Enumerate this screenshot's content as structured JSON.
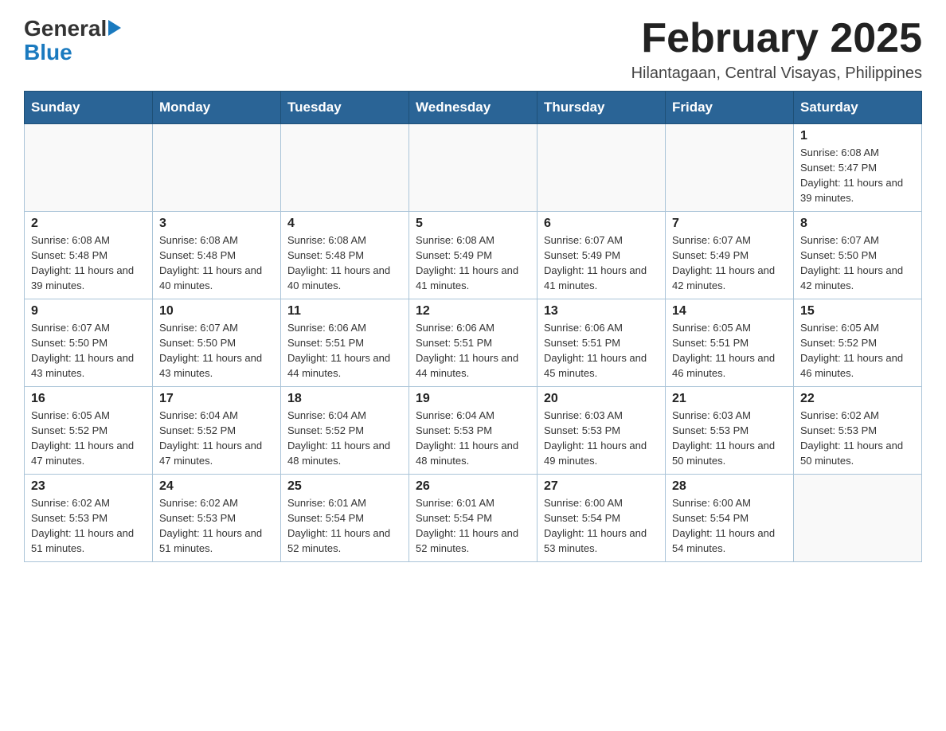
{
  "logo": {
    "general": "General",
    "blue": "Blue",
    "arrow": "▶"
  },
  "header": {
    "title": "February 2025",
    "subtitle": "Hilantagaan, Central Visayas, Philippines"
  },
  "days_of_week": [
    "Sunday",
    "Monday",
    "Tuesday",
    "Wednesday",
    "Thursday",
    "Friday",
    "Saturday"
  ],
  "weeks": [
    [
      {
        "day": "",
        "info": ""
      },
      {
        "day": "",
        "info": ""
      },
      {
        "day": "",
        "info": ""
      },
      {
        "day": "",
        "info": ""
      },
      {
        "day": "",
        "info": ""
      },
      {
        "day": "",
        "info": ""
      },
      {
        "day": "1",
        "info": "Sunrise: 6:08 AM\nSunset: 5:47 PM\nDaylight: 11 hours and 39 minutes."
      }
    ],
    [
      {
        "day": "2",
        "info": "Sunrise: 6:08 AM\nSunset: 5:48 PM\nDaylight: 11 hours and 39 minutes."
      },
      {
        "day": "3",
        "info": "Sunrise: 6:08 AM\nSunset: 5:48 PM\nDaylight: 11 hours and 40 minutes."
      },
      {
        "day": "4",
        "info": "Sunrise: 6:08 AM\nSunset: 5:48 PM\nDaylight: 11 hours and 40 minutes."
      },
      {
        "day": "5",
        "info": "Sunrise: 6:08 AM\nSunset: 5:49 PM\nDaylight: 11 hours and 41 minutes."
      },
      {
        "day": "6",
        "info": "Sunrise: 6:07 AM\nSunset: 5:49 PM\nDaylight: 11 hours and 41 minutes."
      },
      {
        "day": "7",
        "info": "Sunrise: 6:07 AM\nSunset: 5:49 PM\nDaylight: 11 hours and 42 minutes."
      },
      {
        "day": "8",
        "info": "Sunrise: 6:07 AM\nSunset: 5:50 PM\nDaylight: 11 hours and 42 minutes."
      }
    ],
    [
      {
        "day": "9",
        "info": "Sunrise: 6:07 AM\nSunset: 5:50 PM\nDaylight: 11 hours and 43 minutes."
      },
      {
        "day": "10",
        "info": "Sunrise: 6:07 AM\nSunset: 5:50 PM\nDaylight: 11 hours and 43 minutes."
      },
      {
        "day": "11",
        "info": "Sunrise: 6:06 AM\nSunset: 5:51 PM\nDaylight: 11 hours and 44 minutes."
      },
      {
        "day": "12",
        "info": "Sunrise: 6:06 AM\nSunset: 5:51 PM\nDaylight: 11 hours and 44 minutes."
      },
      {
        "day": "13",
        "info": "Sunrise: 6:06 AM\nSunset: 5:51 PM\nDaylight: 11 hours and 45 minutes."
      },
      {
        "day": "14",
        "info": "Sunrise: 6:05 AM\nSunset: 5:51 PM\nDaylight: 11 hours and 46 minutes."
      },
      {
        "day": "15",
        "info": "Sunrise: 6:05 AM\nSunset: 5:52 PM\nDaylight: 11 hours and 46 minutes."
      }
    ],
    [
      {
        "day": "16",
        "info": "Sunrise: 6:05 AM\nSunset: 5:52 PM\nDaylight: 11 hours and 47 minutes."
      },
      {
        "day": "17",
        "info": "Sunrise: 6:04 AM\nSunset: 5:52 PM\nDaylight: 11 hours and 47 minutes."
      },
      {
        "day": "18",
        "info": "Sunrise: 6:04 AM\nSunset: 5:52 PM\nDaylight: 11 hours and 48 minutes."
      },
      {
        "day": "19",
        "info": "Sunrise: 6:04 AM\nSunset: 5:53 PM\nDaylight: 11 hours and 48 minutes."
      },
      {
        "day": "20",
        "info": "Sunrise: 6:03 AM\nSunset: 5:53 PM\nDaylight: 11 hours and 49 minutes."
      },
      {
        "day": "21",
        "info": "Sunrise: 6:03 AM\nSunset: 5:53 PM\nDaylight: 11 hours and 50 minutes."
      },
      {
        "day": "22",
        "info": "Sunrise: 6:02 AM\nSunset: 5:53 PM\nDaylight: 11 hours and 50 minutes."
      }
    ],
    [
      {
        "day": "23",
        "info": "Sunrise: 6:02 AM\nSunset: 5:53 PM\nDaylight: 11 hours and 51 minutes."
      },
      {
        "day": "24",
        "info": "Sunrise: 6:02 AM\nSunset: 5:53 PM\nDaylight: 11 hours and 51 minutes."
      },
      {
        "day": "25",
        "info": "Sunrise: 6:01 AM\nSunset: 5:54 PM\nDaylight: 11 hours and 52 minutes."
      },
      {
        "day": "26",
        "info": "Sunrise: 6:01 AM\nSunset: 5:54 PM\nDaylight: 11 hours and 52 minutes."
      },
      {
        "day": "27",
        "info": "Sunrise: 6:00 AM\nSunset: 5:54 PM\nDaylight: 11 hours and 53 minutes."
      },
      {
        "day": "28",
        "info": "Sunrise: 6:00 AM\nSunset: 5:54 PM\nDaylight: 11 hours and 54 minutes."
      },
      {
        "day": "",
        "info": ""
      }
    ]
  ]
}
